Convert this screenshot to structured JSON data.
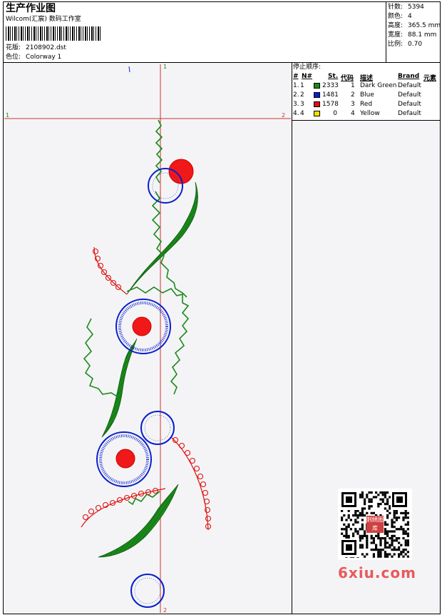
{
  "header": {
    "title": "生产作业图",
    "company": "Wilcom(汇宸) 数码工作室",
    "design_label": "花版:",
    "design_value": "2108902.dst",
    "colorway_label": "色位:",
    "colorway_value": "Colorway 1"
  },
  "stats": [
    {
      "label": "针数:",
      "value": "5394"
    },
    {
      "label": "颜色:",
      "value": "4"
    },
    {
      "label": "高度:",
      "value": "365.5 mm"
    },
    {
      "label": "宽度:",
      "value": "88.1 mm"
    },
    {
      "label": "比例:",
      "value": "0.70"
    }
  ],
  "sequence": {
    "title": "停止顺序:",
    "headers": [
      "#",
      "N#",
      "St.",
      "代码",
      "描述",
      "Brand",
      "元素"
    ],
    "rows": [
      {
        "num": "1.",
        "n": "1",
        "stitches": "2333",
        "code": "1",
        "desc": "Dark Green",
        "brand": "Default",
        "color": "#1a8a1a"
      },
      {
        "num": "2.",
        "n": "2",
        "stitches": "1481",
        "code": "2",
        "desc": "Blue",
        "brand": "Default",
        "color": "#0a1fcc"
      },
      {
        "num": "3.",
        "n": "3",
        "stitches": "1578",
        "code": "3",
        "desc": "Red",
        "brand": "Default",
        "color": "#e01010"
      },
      {
        "num": "4.",
        "n": "4",
        "stitches": "0",
        "code": "4",
        "desc": "Yellow",
        "brand": "Default",
        "color": "#f0e000"
      }
    ]
  },
  "axis_markers": {
    "top": "1",
    "left": "1",
    "right": "2",
    "bottom": "2"
  },
  "watermark": {
    "text": "6xiu.com",
    "stamp": "刺绣图库"
  }
}
